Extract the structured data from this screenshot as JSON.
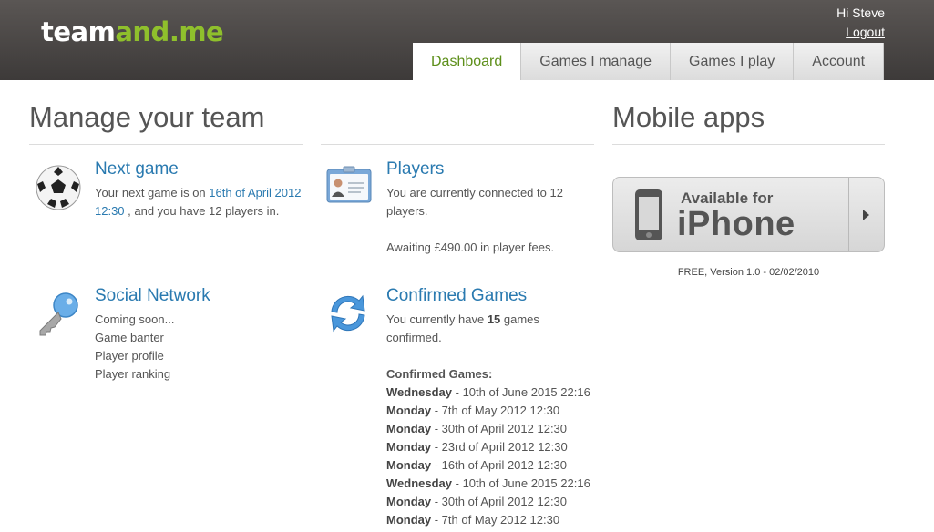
{
  "header": {
    "logo": {
      "part1": "team",
      "part2": "and",
      "part3": ".me"
    },
    "greeting": "Hi Steve",
    "logout": "Logout"
  },
  "tabs": [
    "Dashboard",
    "Games I manage",
    "Games I play",
    "Account"
  ],
  "manage": {
    "title": "Manage your team",
    "next_game": {
      "title": "Next game",
      "text_before": "Your next game is on ",
      "link1": "16th of April 2012",
      "link2": "12:30",
      "text_after": " , and you have 12 players in."
    },
    "players": {
      "title": "Players",
      "line1": "You are currently connected to 12",
      "line2": "players.",
      "line3": "Awaiting £490.00 in player fees."
    },
    "social": {
      "title": "Social Network",
      "items": [
        "Coming soon...",
        "Game banter",
        "Player profile",
        "Player ranking"
      ]
    },
    "confirmed": {
      "title": "Confirmed Games",
      "line1_pre": "You currently have ",
      "count": "15",
      "line1_post": " games",
      "line2": "confirmed.",
      "list_title": "Confirmed Games:",
      "games": [
        {
          "day": "Wednesday",
          "date": " - 10th of June 2015 22:16"
        },
        {
          "day": "Monday",
          "date": " - 7th of May 2012 12:30"
        },
        {
          "day": "Monday",
          "date": " - 30th of April 2012 12:30"
        },
        {
          "day": "Monday",
          "date": " - 23rd of April 2012 12:30"
        },
        {
          "day": "Monday",
          "date": " - 16th of April 2012 12:30"
        },
        {
          "day": "Wednesday",
          "date": " - 10th of June 2015 22:16"
        },
        {
          "day": "Monday",
          "date": " - 30th of April 2012 12:30"
        },
        {
          "day": "Monday",
          "date": " - 7th of May 2012 12:30"
        }
      ]
    }
  },
  "mobile": {
    "title": "Mobile apps",
    "button_small": "Available for",
    "button_big": "iPhone",
    "version": "FREE, Version 1.0 - 02/02/2010"
  },
  "colors": {
    "accent_green": "#8fc02c",
    "link_blue": "#2a7ab0",
    "header_dark": "#3d3a39"
  }
}
